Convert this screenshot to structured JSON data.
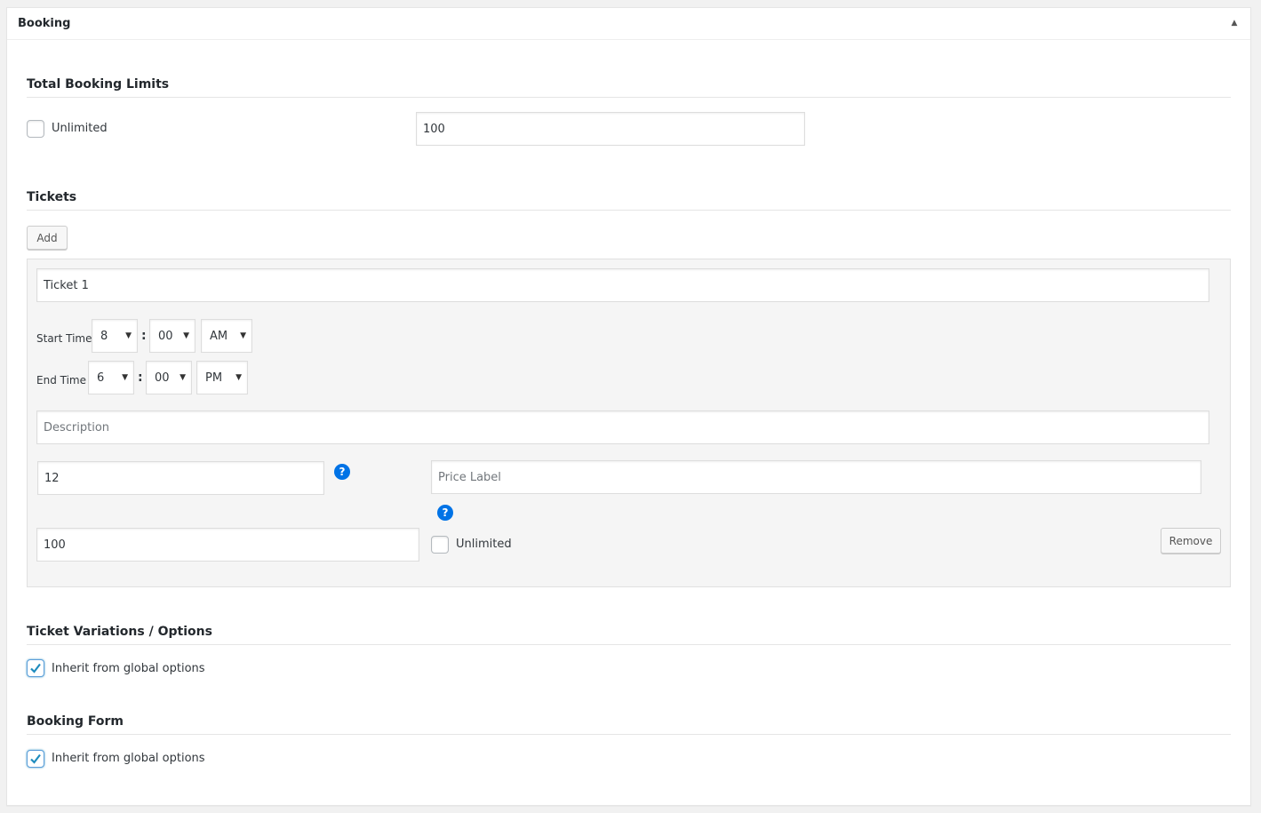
{
  "box": {
    "title": "Booking"
  },
  "total_limits": {
    "title": "Total Booking Limits",
    "unlimited_label": "Unlimited",
    "unlimited_checked": false,
    "limit_value": "100"
  },
  "tickets": {
    "title": "Tickets",
    "add_label": "Add",
    "items": [
      {
        "name": "Ticket 1",
        "start_time_label": "Start Time",
        "start_hour": "8",
        "start_minute": "00",
        "start_ampm": "AM",
        "end_time_label": "End Time",
        "end_hour": "6",
        "end_minute": "00",
        "end_ampm": "PM",
        "description_placeholder": "Description",
        "price": "12",
        "price_label_placeholder": "Price Label",
        "capacity": "100",
        "unlimited_label": "Unlimited",
        "unlimited_checked": false,
        "remove_label": "Remove",
        "help_glyph": "?"
      }
    ],
    "colon": ":"
  },
  "variations": {
    "title": "Ticket Variations / Options",
    "inherit_label": "Inherit from global options",
    "inherit_checked": true
  },
  "booking_form": {
    "title": "Booking Form",
    "inherit_label": "Inherit from global options",
    "inherit_checked": true
  },
  "colors": {
    "accent": "#0073e6",
    "check": "#1e8cbe"
  }
}
